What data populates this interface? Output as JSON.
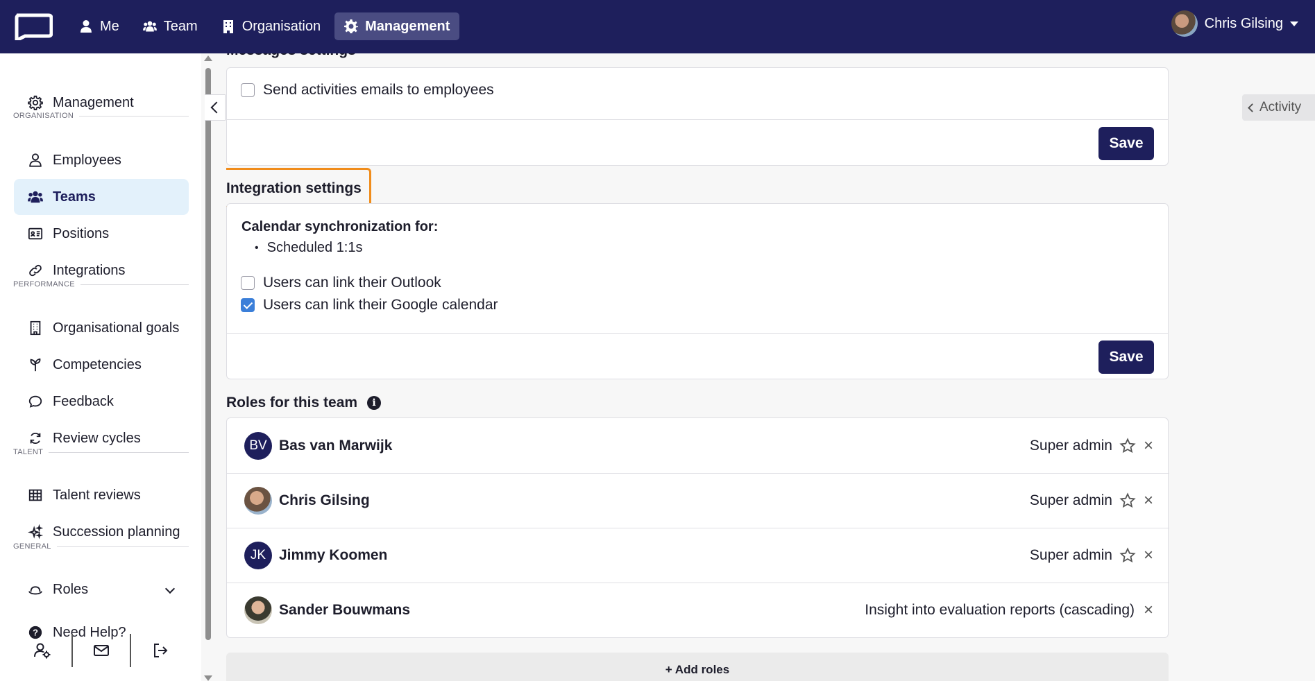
{
  "topnav": {
    "items": [
      {
        "label": "Me"
      },
      {
        "label": "Team"
      },
      {
        "label": "Organisation"
      },
      {
        "label": "Management"
      }
    ],
    "user_name": "Chris Gilsing"
  },
  "sidebar": {
    "management": "Management",
    "sections": {
      "organisation": "ORGANISATION",
      "performance": "PERFORMANCE",
      "talent": "TALENT",
      "general": "GENERAL"
    },
    "items": {
      "employees": "Employees",
      "teams": "Teams",
      "positions": "Positions",
      "integrations": "Integrations",
      "org_goals": "Organisational goals",
      "competencies": "Competencies",
      "feedback": "Feedback",
      "review_cycles": "Review cycles",
      "talent_reviews": "Talent reviews",
      "succession": "Succession planning",
      "roles": "Roles",
      "help": "Need Help?"
    }
  },
  "messages": {
    "title": "Messages settings",
    "send_emails": "Send activities emails to employees",
    "send_emails_checked": false,
    "save": "Save"
  },
  "integration": {
    "title": "Integration settings",
    "calendar_heading": "Calendar synchronization for:",
    "calendar_item": "Scheduled 1:1s",
    "outlook": "Users can link their Outlook",
    "outlook_checked": false,
    "google": "Users can link their Google calendar",
    "google_checked": true,
    "save": "Save"
  },
  "roles": {
    "title": "Roles for this team",
    "rows": [
      {
        "initials": "BV",
        "name": "Bas van Marwijk",
        "role": "Super admin"
      },
      {
        "initials": "",
        "name": "Chris Gilsing",
        "role": "Super admin"
      },
      {
        "initials": "JK",
        "name": "Jimmy Koomen",
        "role": "Super admin"
      },
      {
        "initials": "",
        "name": "Sander Bouwmans",
        "role": "Insight into evaluation reports (cascading)"
      }
    ],
    "add_label": "+ Add roles"
  },
  "activity": "Activity",
  "colors": {
    "nav_bg": "#1e1f5c",
    "accent": "#1e1f5c",
    "active_bg": "#e3f1fb",
    "highlight": "#f08c1b",
    "checkbox": "#3b7fd9"
  }
}
